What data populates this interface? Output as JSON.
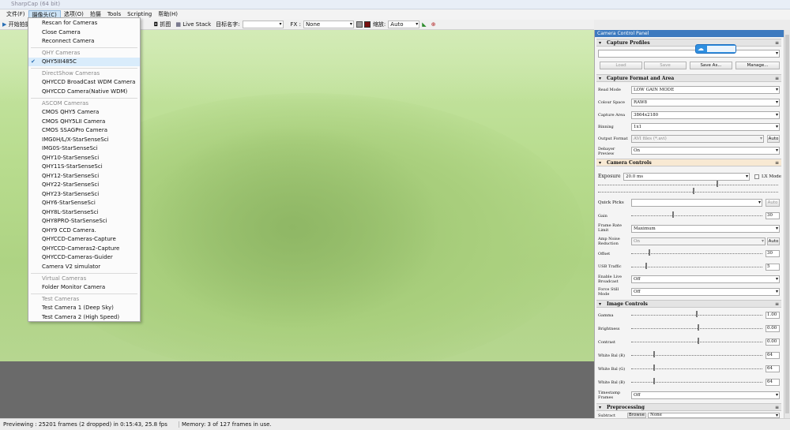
{
  "window": {
    "title": "SharpCap (64 bit)"
  },
  "menu": [
    "文件(F)",
    "摄像头(C)",
    "选项(O)",
    "拍摄",
    "Tools",
    "Scripting",
    "帮助(H)"
  ],
  "toolbar": {
    "start_capture": "开始拍摄",
    "snapshot": "抓图",
    "live_stack": "Live Stack",
    "target_name_label": "目标名字:",
    "fx_label": "FX :",
    "fx_value": "None",
    "zoom_label": "缩放:",
    "zoom_value": "Auto"
  },
  "camera_menu": {
    "items": [
      {
        "label": "Rescan for Cameras",
        "kind": "item"
      },
      {
        "label": "Close Camera",
        "kind": "item"
      },
      {
        "label": "Reconnect Camera",
        "kind": "item"
      },
      {
        "label": "QHY Cameras",
        "kind": "header"
      },
      {
        "label": "QHY5III485C",
        "kind": "checked"
      },
      {
        "label": "DirectShow Cameras",
        "kind": "header"
      },
      {
        "label": "QHYCCD BroadCast WDM Camera",
        "kind": "item"
      },
      {
        "label": "QHYCCD Camera(Native WDM)",
        "kind": "item"
      },
      {
        "label": "ASCOM Cameras",
        "kind": "header"
      },
      {
        "label": "CMOS QHY5 Camera",
        "kind": "item"
      },
      {
        "label": "CMOS QHY5LII Camera",
        "kind": "item"
      },
      {
        "label": "CMOS SSAGPro Camera",
        "kind": "item"
      },
      {
        "label": "IMG0H/L/X-StarSenseSci",
        "kind": "item"
      },
      {
        "label": "IMG0S-StarSenseSci",
        "kind": "item"
      },
      {
        "label": "QHY10-StarSenseSci",
        "kind": "item"
      },
      {
        "label": "QHY11S-StarSenseSci",
        "kind": "item"
      },
      {
        "label": "QHY12-StarSenseSci",
        "kind": "item"
      },
      {
        "label": "QHY22-StarSenseSci",
        "kind": "item"
      },
      {
        "label": "QHY23-StarSenseSci",
        "kind": "item"
      },
      {
        "label": "QHY6-StarSenseSci",
        "kind": "item"
      },
      {
        "label": "QHY8L-StarSenseSci",
        "kind": "item"
      },
      {
        "label": "QHY8PRO-StarSenseSci",
        "kind": "item"
      },
      {
        "label": "QHY9 CCD Camera.",
        "kind": "item"
      },
      {
        "label": "QHYCCD-Cameras-Capture",
        "kind": "item"
      },
      {
        "label": "QHYCCD-Cameras2-Capture",
        "kind": "item"
      },
      {
        "label": "QHYCCD-Cameras-Guider",
        "kind": "item"
      },
      {
        "label": "Camera V2 simulator",
        "kind": "item"
      },
      {
        "label": "Virtual Cameras",
        "kind": "header"
      },
      {
        "label": "Folder Monitor Camera",
        "kind": "item"
      },
      {
        "label": "Test Cameras",
        "kind": "header"
      },
      {
        "label": "Test Camera 1 (Deep Sky)",
        "kind": "item"
      },
      {
        "label": "Test Camera 2 (High Speed)",
        "kind": "item"
      }
    ]
  },
  "panel": {
    "title": "Camera Control Panel",
    "capture_profiles": {
      "header": "Capture Profiles",
      "buttons": [
        "Load",
        "Save",
        "Save As...",
        "Manage..."
      ]
    },
    "format": {
      "header": "Capture Format and Area",
      "fields": [
        {
          "label": "Read Mode",
          "value": "LOW GAIN MODE"
        },
        {
          "label": "Colour Space",
          "value": "RAW8"
        },
        {
          "label": "Capture Area",
          "value": "3864x2180"
        },
        {
          "label": "Binning",
          "value": "1x1"
        },
        {
          "label": "Output Format",
          "value": "AVI files (*.avi)"
        },
        {
          "label": "Debayer Preview",
          "value": "On"
        }
      ],
      "auto_label": "Auto"
    },
    "camera_controls": {
      "header": "Camera Controls",
      "exposure_label": "Exposure",
      "exposure_value": "20.0 ms",
      "lx_mode": "LX Mode",
      "quick_picks": "Quick Picks",
      "auto_label": "Auto",
      "gain_label": "Gain",
      "gain_value": "30",
      "frame_rate_label": "Frame Rate Limit",
      "frame_rate_value": "Maximum",
      "amp_label": "Amp Noise Reduction",
      "amp_value": "On",
      "offset_label": "Offset",
      "offset_value": "30",
      "usb_label": "USB Traffic",
      "usb_value": "5",
      "broadcast_label": "Enable Live Broadcast",
      "broadcast_value": "Off",
      "still_label": "Force Still Mode",
      "still_value": "Off"
    },
    "image_controls": {
      "header": "Image Controls",
      "gamma_label": "Gamma",
      "gamma_value": "1.00",
      "brightness_label": "Brightness",
      "brightness_value": "0.00",
      "contrast_label": "Contrast",
      "contrast_value": "0.00",
      "wb_r_label": "White Bal (R)",
      "wb_r_value": "64",
      "wb_g_label": "White Bal (G)",
      "wb_g_value": "64",
      "wb_b_label": "White Bal (B)",
      "wb_b_value": "64",
      "timestamp_label": "Timestamp Frames",
      "timestamp_value": "Off"
    },
    "preprocessing": {
      "header": "Preprocessing",
      "subtract_dark_label": "Subtract Dark",
      "browse_label": "Browse",
      "subtract_dark_value": "None"
    }
  },
  "status": {
    "previewing": "Previewing : 25201 frames (2 dropped) in 0:15:43, 25.8 fps",
    "memory": "Memory: 3 of 127 frames in use."
  },
  "colors": {
    "accent": "#3d7abf",
    "preview_green": "#b8dc8e",
    "highlight": "#f8e9d3"
  }
}
